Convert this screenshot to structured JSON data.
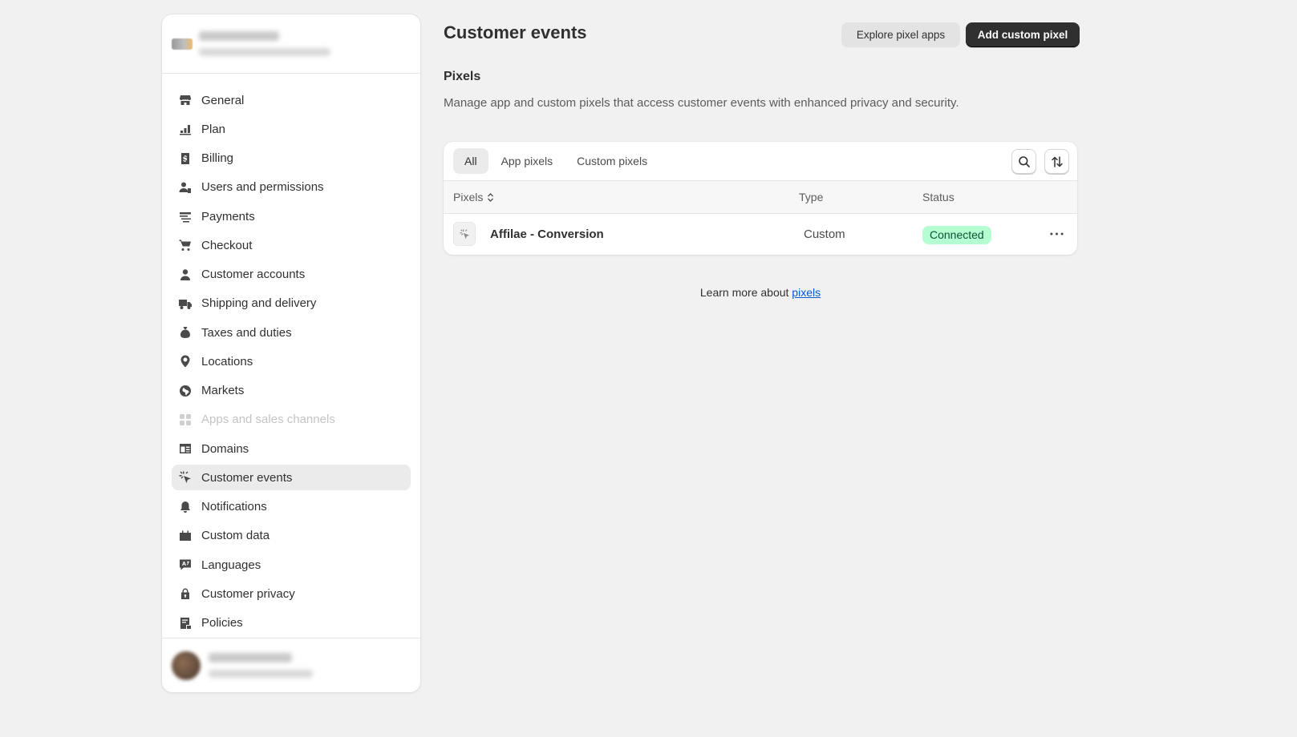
{
  "sidebar": {
    "items": [
      {
        "label": "General",
        "icon": "store-icon"
      },
      {
        "label": "Plan",
        "icon": "plan-icon"
      },
      {
        "label": "Billing",
        "icon": "billing-icon"
      },
      {
        "label": "Users and permissions",
        "icon": "users-icon"
      },
      {
        "label": "Payments",
        "icon": "payments-icon"
      },
      {
        "label": "Checkout",
        "icon": "cart-icon"
      },
      {
        "label": "Customer accounts",
        "icon": "person-icon"
      },
      {
        "label": "Shipping and delivery",
        "icon": "truck-icon"
      },
      {
        "label": "Taxes and duties",
        "icon": "taxes-icon"
      },
      {
        "label": "Locations",
        "icon": "location-pin-icon"
      },
      {
        "label": "Markets",
        "icon": "globe-icon"
      },
      {
        "label": "Apps and sales channels",
        "icon": "apps-icon"
      },
      {
        "label": "Domains",
        "icon": "domains-icon"
      },
      {
        "label": "Customer events",
        "icon": "cursor-click-icon"
      },
      {
        "label": "Notifications",
        "icon": "bell-icon"
      },
      {
        "label": "Custom data",
        "icon": "custom-data-icon"
      },
      {
        "label": "Languages",
        "icon": "languages-icon"
      },
      {
        "label": "Customer privacy",
        "icon": "lock-icon"
      },
      {
        "label": "Policies",
        "icon": "policies-icon"
      }
    ],
    "active_index": 13,
    "disabled_index": 11
  },
  "header": {
    "title": "Customer events",
    "explore_button": "Explore pixel apps",
    "add_button": "Add custom pixel"
  },
  "pixels_section": {
    "title": "Pixels",
    "description": "Manage app and custom pixels that access customer events with enhanced privacy and security."
  },
  "table": {
    "tabs": [
      "All",
      "App pixels",
      "Custom pixels"
    ],
    "active_tab": "All",
    "columns": {
      "pixels": "Pixels",
      "type": "Type",
      "status": "Status"
    },
    "rows": [
      {
        "name": "Affilae - Conversion",
        "type": "Custom",
        "status": "Connected"
      }
    ]
  },
  "footer_note": {
    "text": "Learn more about ",
    "link": "pixels"
  },
  "colors": {
    "accent_dark": "#303030",
    "badge_success_bg": "#b4fed2",
    "badge_success_text": "#0c5132",
    "link": "#005bd3"
  }
}
